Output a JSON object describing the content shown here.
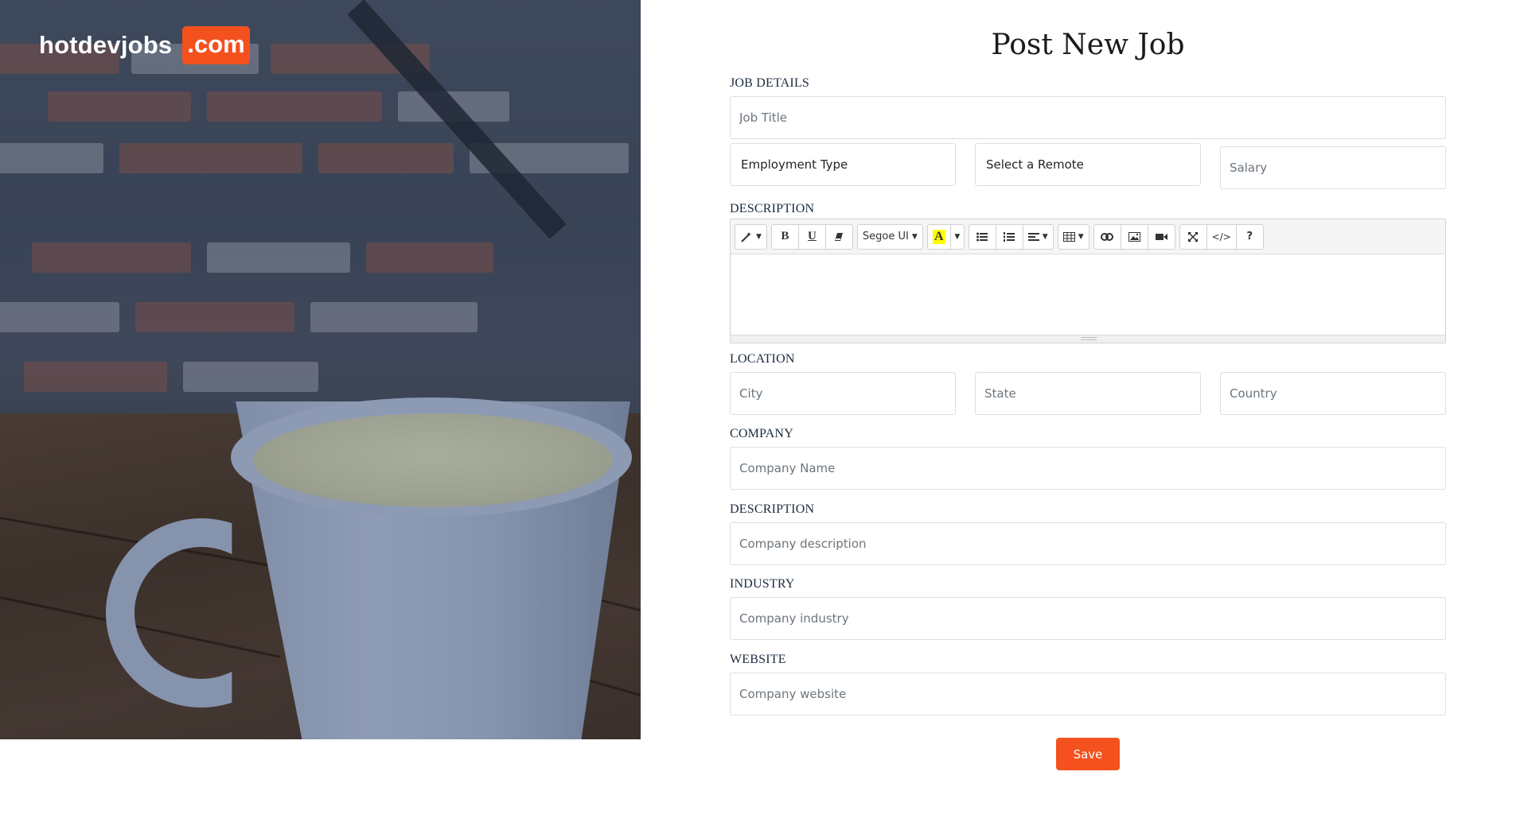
{
  "brand": {
    "name": "hotdevjobs",
    "tld": ".com",
    "accent": "#f4511e"
  },
  "page": {
    "title": "Post New Job"
  },
  "sections": {
    "job_details": "JOB DETAILS",
    "description": "DESCRIPTION",
    "location": "LOCATION",
    "company": "COMPANY",
    "company_description": "DESCRIPTION",
    "industry": "INDUSTRY",
    "website": "WEBSITE"
  },
  "fields": {
    "job_title": {
      "placeholder": "Job Title",
      "value": ""
    },
    "employment_type": {
      "value": "Employment Type"
    },
    "remote": {
      "value": "Select a Remote"
    },
    "salary": {
      "placeholder": "Salary",
      "value": ""
    },
    "city": {
      "placeholder": "City",
      "value": ""
    },
    "state": {
      "placeholder": "State",
      "value": ""
    },
    "country": {
      "placeholder": "Country",
      "value": ""
    },
    "company_name": {
      "placeholder": "Company Name",
      "value": ""
    },
    "company_description": {
      "placeholder": "Company description",
      "value": ""
    },
    "company_industry": {
      "placeholder": "Company industry",
      "value": ""
    },
    "company_website": {
      "placeholder": "Company website",
      "value": ""
    }
  },
  "editor": {
    "font_name": "Segoe UI",
    "toolbar_icons": [
      "magic-wand-icon",
      "bold-icon",
      "underline-icon",
      "eraser-icon",
      "font-color-icon",
      "unordered-list-icon",
      "ordered-list-icon",
      "align-icon",
      "table-icon",
      "link-icon",
      "picture-icon",
      "video-icon",
      "fullscreen-icon",
      "code-view-icon",
      "help-icon"
    ],
    "help_label": "?"
  },
  "actions": {
    "save_label": "Save"
  }
}
